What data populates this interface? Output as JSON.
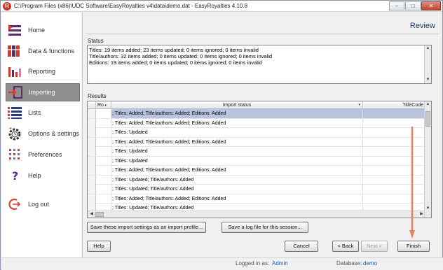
{
  "window": {
    "title": "C:\\Program Files (x86)\\UDC Software\\EasyRoyalties v4\\data\\demo.dat - EasyRoyalties 4.10.8",
    "app_icon_letter": "R",
    "minimize": "–",
    "maximize": "□",
    "close": "✕"
  },
  "sidebar": {
    "items": [
      {
        "label": "Home",
        "icon": "home-list-icon"
      },
      {
        "label": "Data & functions",
        "icon": "books-icon"
      },
      {
        "label": "Reporting",
        "icon": "bar-chart-icon"
      },
      {
        "label": "Importing",
        "icon": "import-icon"
      },
      {
        "label": "Lists",
        "icon": "list-icon"
      },
      {
        "label": "Options & settings",
        "icon": "gear-clock-icon"
      },
      {
        "label": "Preferences",
        "icon": "grid-dots-icon"
      },
      {
        "label": "Help",
        "icon": "question-icon"
      },
      {
        "label": "Log out",
        "icon": "logout-icon"
      }
    ],
    "active": "Importing"
  },
  "main": {
    "heading": "Review",
    "status_label": "Status",
    "status_lines": [
      "Titles: 19 items added; 23 items updated; 0 items ignored; 0 items invalid",
      "Title/authors: 32 items added; 0 items updated; 0 items ignored; 0 items invalid",
      "Editions: 19 items added; 0 items updated; 0 items ignored; 0 items invalid"
    ],
    "results_label": "Results",
    "columns": {
      "row": "Ro",
      "status": "Import status",
      "titlecode": "TitleCode"
    },
    "rows": [
      "; Titles: Added; Title/authors: Added; Editions: Added",
      "; Titles: Added; Title/authors: Added; Editions: Added",
      "; Titles: Updated",
      "; Titles: Added; Title/authors: Added; Editions: Added",
      "; Titles: Updated",
      "; Titles: Updated",
      "; Titles: Added; Title/authors: Added; Editions: Added",
      "; Titles: Updated; Title/authors: Added",
      "; Titles: Updated; Title/authors: Added",
      "; Titles: Added; Title/authors: Added; Editions: Added",
      "; Titles: Updated; Title/authors: Added"
    ],
    "buttons": {
      "save_profile": "Save these import settings as an import profile...",
      "save_log": "Save a log file for this session...",
      "help": "Help",
      "cancel": "Cancel",
      "back": "< Back",
      "next": "Next >",
      "finish": "Finish"
    }
  },
  "statusbar": {
    "logged_in_label": "Logged in as:",
    "user": "Admin",
    "database_label": "Database:",
    "database": "demo"
  },
  "colors": {
    "selected_row": "#b8c4de",
    "active_nav": "#8e8e8e",
    "accent_arrow": "#e8825a",
    "heading": "#1f3a6a"
  }
}
